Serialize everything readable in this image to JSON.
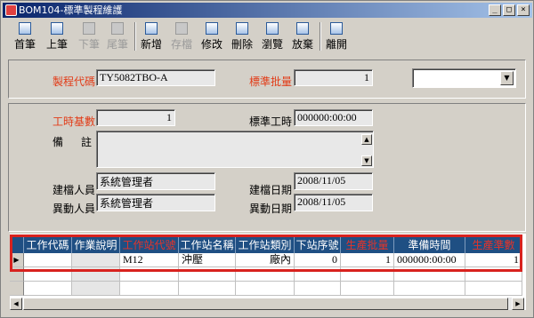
{
  "window": {
    "title": "BOM104-標準製程維護",
    "min_label": "_",
    "max_label": "□",
    "close_label": "×"
  },
  "toolbar": {
    "buttons": [
      {
        "label": "首筆",
        "icon": "first-record-icon",
        "enabled": true
      },
      {
        "label": "上筆",
        "icon": "prev-record-icon",
        "enabled": true
      },
      {
        "label": "下筆",
        "icon": "next-record-icon",
        "enabled": false
      },
      {
        "label": "尾筆",
        "icon": "last-record-icon",
        "enabled": false
      },
      {
        "label": "新增",
        "icon": "new-icon",
        "enabled": true
      },
      {
        "label": "存檔",
        "icon": "save-icon",
        "enabled": false
      },
      {
        "label": "修改",
        "icon": "edit-icon",
        "enabled": true
      },
      {
        "label": "刪除",
        "icon": "delete-icon",
        "enabled": true
      },
      {
        "label": "瀏覽",
        "icon": "browse-icon",
        "enabled": true
      },
      {
        "label": "放棄",
        "icon": "abandon-icon",
        "enabled": true
      },
      {
        "label": "離開",
        "icon": "exit-icon",
        "enabled": true
      }
    ]
  },
  "header": {
    "process_code_label": "製程代碼",
    "process_code_value": "TY5082TBO-A",
    "std_batch_label": "標準批量",
    "std_batch_value": "1",
    "combo_value": ""
  },
  "detail": {
    "hour_base_label": "工時基數",
    "hour_base_value": "1",
    "std_hours_label": "標準工時",
    "std_hours_value": "000000:00:00",
    "remark_label_1": "備",
    "remark_label_2": "註",
    "remark_value": "",
    "created_by_label": "建檔人員",
    "created_by_value": "系統管理者",
    "created_date_label": "建檔日期",
    "created_date_value": "2008/11/05",
    "modified_by_label": "異動人員",
    "modified_by_value": "系統管理者",
    "modified_date_label": "異動日期",
    "modified_date_value": "2008/11/05"
  },
  "grid": {
    "columns": [
      "工作代碼",
      "作業說明",
      "工作站代號",
      "工作站名稱",
      "工作站類別",
      "下站序號",
      "生產批量",
      "準備時間",
      "生產準數"
    ],
    "required_columns": [
      2,
      6,
      8
    ],
    "rows": [
      [
        "",
        "",
        "M12",
        "沖壓",
        "廠內",
        "0",
        "1",
        "000000:00:00",
        "1"
      ]
    ],
    "row_indicator": "▶"
  },
  "colors": {
    "required_label": "#e23b17",
    "grid_header_bg": "#1f4f83",
    "highlight_border": "#d8221e"
  }
}
